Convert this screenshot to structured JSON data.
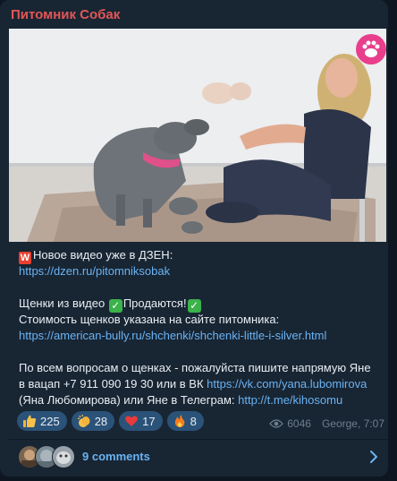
{
  "channel": {
    "name": "Питомник Собак"
  },
  "post": {
    "line1_text": "Новое видео уже в ДЗЕН:",
    "line1_emoji": "W",
    "dzen_link": "https://dzen.ru/pitomniksobak",
    "line3_a": "Щенки из видео ",
    "line3_b": "Продаются!",
    "line4": "Стоимость щенков указана на сайте питомника:",
    "site_link": "https://american-bully.ru/shchenki/shchenki-little-i-silver.html",
    "line6": "По всем вопросам о щенках - пожалуйста пишите напрямую Яне",
    "line7_text": "в вацап +7 911 090 19 30 или в ВК ",
    "vk_link": "https://vk.com/yana.lubomirova",
    "line8_text": "(Яна Любомирова) или Яне в Телеграм: ",
    "tg_link": "http://t.me/kihosomu"
  },
  "reactions": [
    {
      "icon": "thumbs-up-icon",
      "count": "225"
    },
    {
      "icon": "clapping-hands-icon",
      "count": "28"
    },
    {
      "icon": "heart-icon",
      "count": "17"
    },
    {
      "icon": "fire-icon",
      "count": "8"
    }
  ],
  "meta": {
    "views": "6046",
    "author_time": "George, 7:07"
  },
  "comments": {
    "label": "9 comments"
  },
  "colors": {
    "accent": "#6ab3f3",
    "channel": "#e35656",
    "bubble": "#182533",
    "reaction_bg": "#2b5278"
  }
}
